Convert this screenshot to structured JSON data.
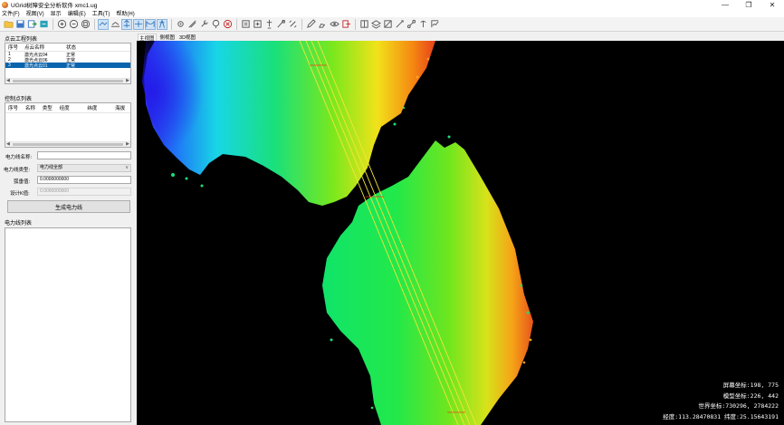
{
  "window": {
    "title": "UGrid树障安全分析软件 xmc1.ug",
    "minimize": "—",
    "maximize": "❐",
    "close": "✕"
  },
  "menu": [
    "文件(F)",
    "视图(V)",
    "显示",
    "编辑(E)",
    "工具(T)",
    "帮助(H)"
  ],
  "toolbar_icons": [
    "folder-open-icon",
    "save-icon",
    "export-icon",
    "import-icon",
    "zoom-in-icon",
    "zoom-out-icon",
    "zoom-fit-icon",
    "pan-icon",
    "rotate-icon",
    "profile-icon",
    "section-icon",
    "span-icon",
    "settings-icon",
    "measure-icon",
    "wrench-icon",
    "tree-icon",
    "delete-icon",
    "layer-icon",
    "add-icon",
    "marker-icon",
    "tower-icon",
    "line-icon",
    "pen-icon",
    "edit-icon",
    "eye-icon",
    "exit-icon",
    "clip-icon",
    "layers-icon",
    "ruler-icon",
    "distance-icon",
    "link-icon",
    "angle-icon",
    "chart-icon"
  ],
  "point_project_panel": {
    "title": "点云工程列表",
    "columns": [
      "序号",
      "点云名称",
      "状态"
    ],
    "rows": [
      {
        "no": "1",
        "name": "激光点云04",
        "status": "正常"
      },
      {
        "no": "2",
        "name": "激光点云06",
        "status": "正常"
      },
      {
        "no": "3",
        "name": "激光点云01",
        "status": "正常"
      }
    ],
    "selected_row": 3
  },
  "control_points_panel": {
    "title": "控制点列表",
    "columns": [
      "序号",
      "名称",
      "类型",
      "经度",
      "纬度",
      "海拔"
    ]
  },
  "power_form": {
    "name_label": "电力线名称:",
    "name_value": "",
    "type_label": "电力线类型:",
    "type_value": "电力线全部",
    "sag_label": "弧垂值:",
    "sag_value": "0.0000000000",
    "design_label": "设计K值:",
    "design_value": "0.0000000000",
    "generate_button": "生成电力线"
  },
  "power_list_panel": {
    "title": "电力线列表"
  },
  "view_tabs": [
    "主视图",
    "侧视图",
    "3D视图"
  ],
  "active_tab": 0,
  "coordinates": {
    "screen": "屏幕坐标:198, 775",
    "model": "模型坐标:226, 442",
    "world": "世界坐标:730296, 2784222",
    "lonlat": "经度:113.28470831 纬度:25.15643191"
  },
  "colors": {
    "accent_selected": "#0a64ad",
    "powerline": "#f2e63a",
    "viewport_bg": "#000000"
  }
}
